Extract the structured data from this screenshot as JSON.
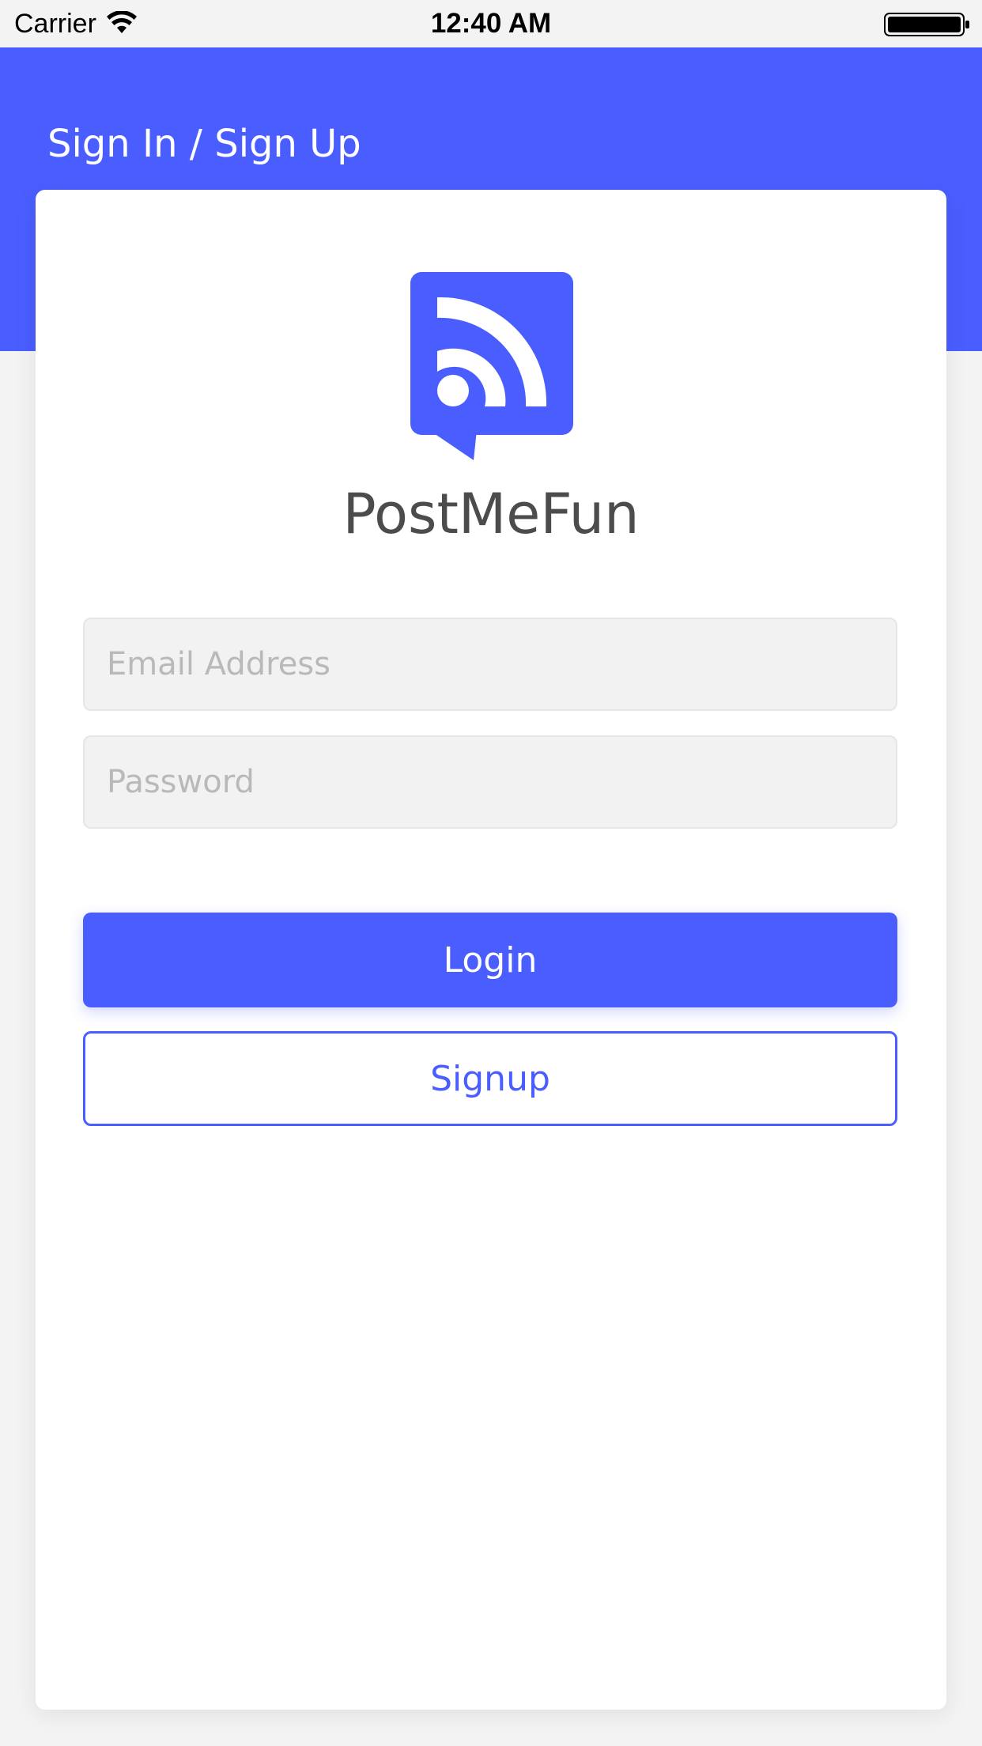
{
  "status_bar": {
    "carrier": "Carrier",
    "time": "12:40 AM",
    "wifi_icon": "wifi-icon",
    "battery_icon": "battery-icon"
  },
  "header": {
    "title": "Sign In / Sign Up",
    "background_color": "#4a5eff"
  },
  "card": {
    "logo_icon": "rss-feed-chat-bubble-icon",
    "app_name": "PostMeFun"
  },
  "form": {
    "email_placeholder": "Email Address",
    "email_value": "",
    "password_placeholder": "Password",
    "password_value": "",
    "login_label": "Login",
    "signup_label": "Signup"
  },
  "colors": {
    "accent": "#4a5eff",
    "page_background": "#f3f3f3",
    "card_background": "#ffffff",
    "field_background": "#f2f2f2",
    "title_text": "#4c4c4c"
  }
}
